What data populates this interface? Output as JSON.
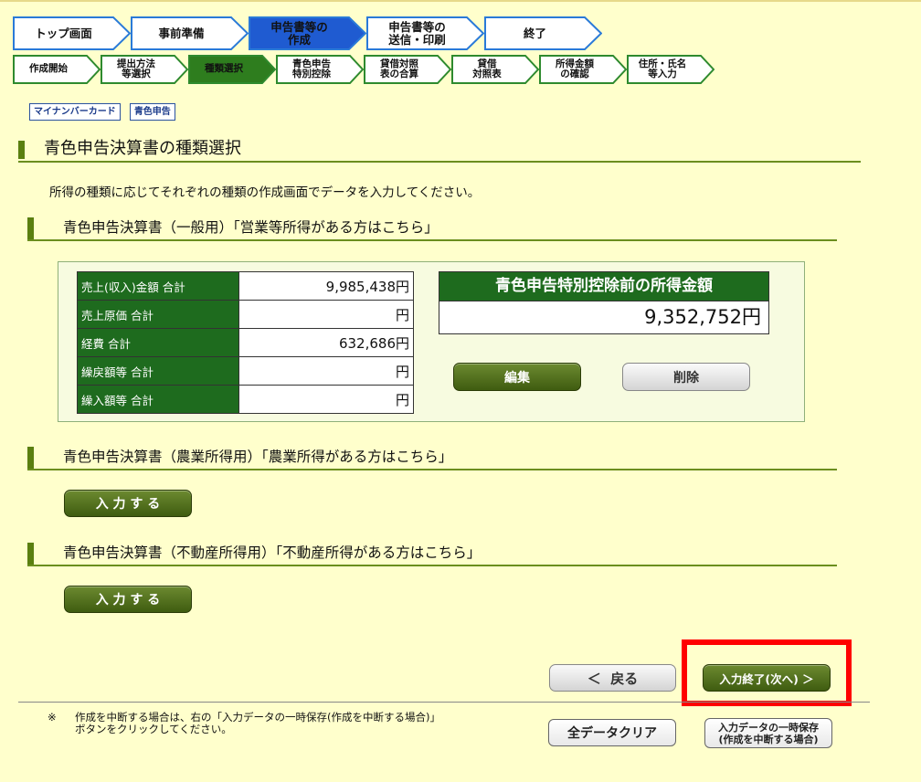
{
  "steps_main": [
    {
      "label": "トップ画面",
      "active": false
    },
    {
      "label": "事前準備",
      "active": false
    },
    {
      "label": "申告書等の\n作成",
      "active": true
    },
    {
      "label": "申告書等の\n送信・印刷",
      "active": false
    },
    {
      "label": "終了",
      "active": false
    }
  ],
  "steps_sub": [
    {
      "label": "作成開始",
      "active": false
    },
    {
      "label": "提出方法\n等選択",
      "active": false
    },
    {
      "label": "種類選択",
      "active": true
    },
    {
      "label": "青色申告\n特別控除",
      "active": false
    },
    {
      "label": "貸借対照\n表の合算",
      "active": false
    },
    {
      "label": "貸借\n対照表",
      "active": false
    },
    {
      "label": "所得金額\nの確認",
      "active": false
    },
    {
      "label": "住所・氏名\n等入力",
      "active": false
    }
  ],
  "badges": {
    "mynumber": "マイナンバーカード",
    "blue": "青色申告"
  },
  "page": {
    "title": "青色申告決算書の種類選択",
    "intro": "所得の種類に応じてそれぞれの種類の作成画面でデータを入力してください。"
  },
  "sections": {
    "general": {
      "title": "青色申告決算書（一般用）「営業等所得がある方はこちら」",
      "rows": [
        {
          "label": "売上(収入)金額 合計",
          "value": "9,985,438円"
        },
        {
          "label": "売上原価 合計",
          "value": "円"
        },
        {
          "label": "経費 合計",
          "value": "632,686円"
        },
        {
          "label": "繰戻額等 合計",
          "value": "円"
        },
        {
          "label": "繰入額等 合計",
          "value": "円"
        }
      ],
      "income_label": "青色申告特別控除前の所得金額",
      "income_value": "9,352,752円",
      "edit_button": "編集",
      "delete_button": "削除"
    },
    "agriculture": {
      "title": "青色申告決算書（農業所得用）「農業所得がある方はこちら」",
      "input_button": "入 力 す る"
    },
    "realestate": {
      "title": "青色申告決算書（不動産所得用）「不動産所得がある方はこちら」",
      "input_button": "入 力 す る"
    }
  },
  "nav": {
    "back_button": "＜  戻る",
    "next_button": "入力終了(次へ) ＞",
    "clear_button": "全データクリア",
    "save_line1": "入力データの一時保存",
    "save_line2": "(作成を中断する場合)"
  },
  "footer_note": {
    "mark": "※",
    "text": "作成を中断する場合は、右の「入力データの一時保存(作成を中断する場合)」ボタンをクリックしてください。"
  },
  "colors": {
    "background": "#ffffcc",
    "active_step": "#1f5bd1",
    "active_substep": "#2e7d1e",
    "header_green": "#1e6b1e",
    "highlight": "#ff0000"
  }
}
